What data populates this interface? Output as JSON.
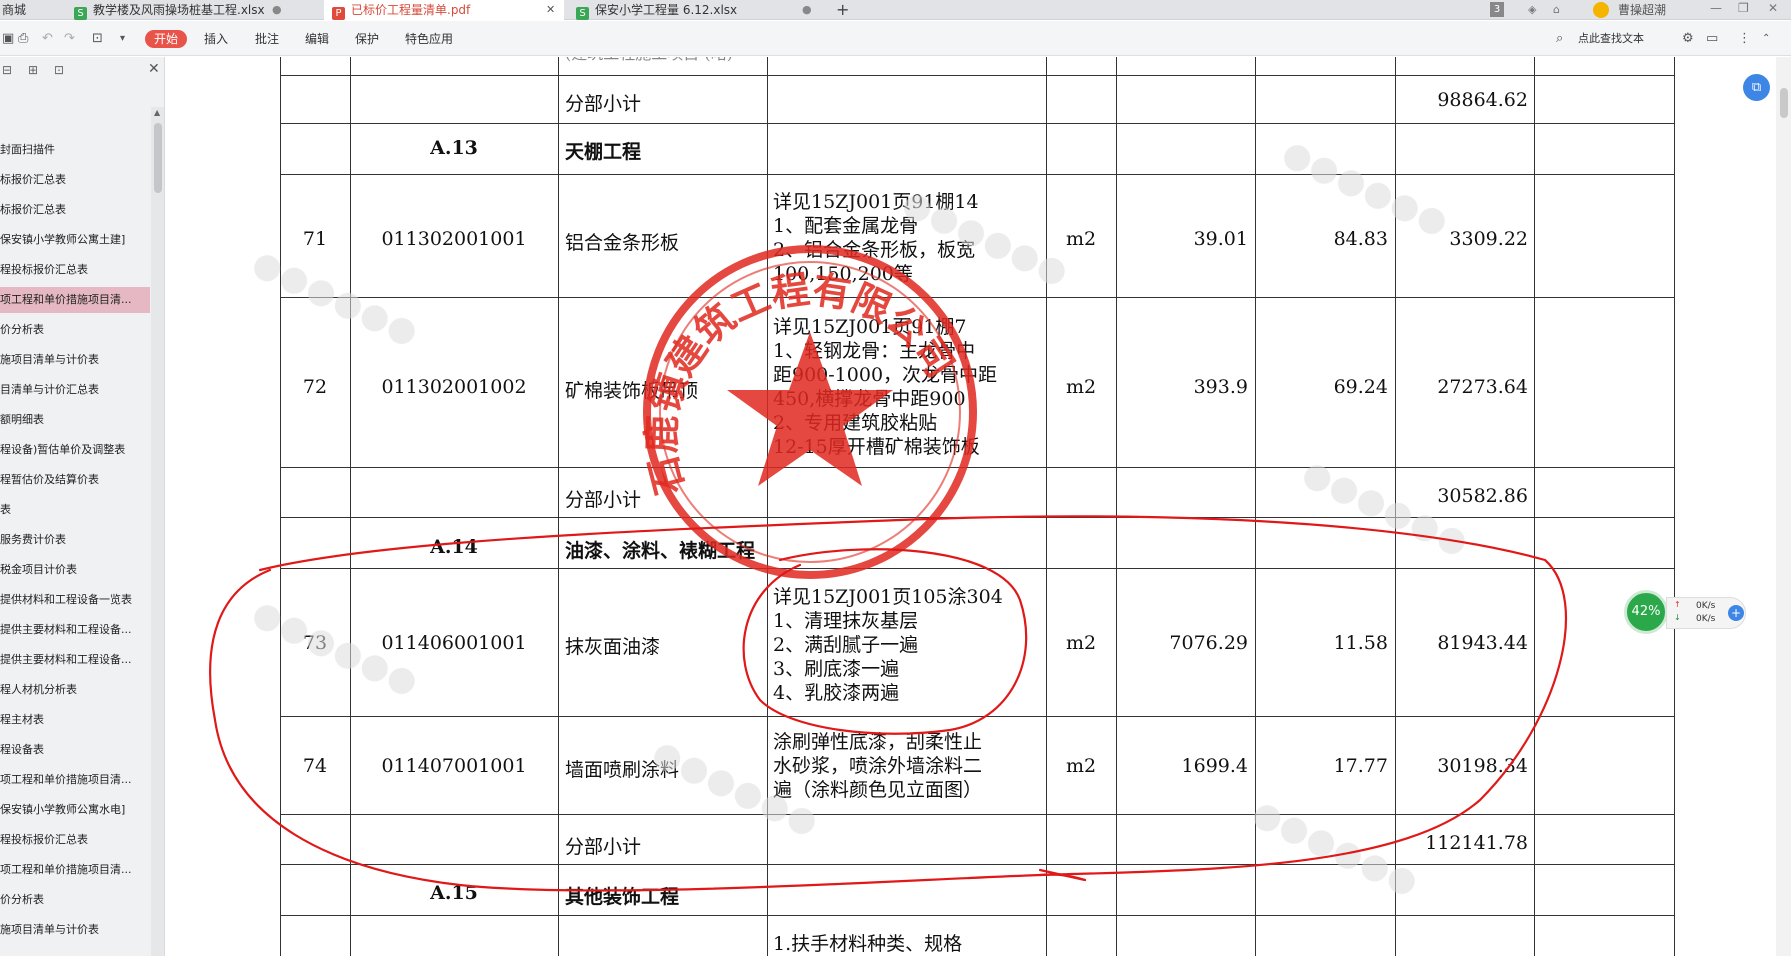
{
  "tabs": [
    {
      "label": "商城"
    },
    {
      "label": "教学楼及风雨操场桩基工程.xlsx",
      "icon": "S"
    },
    {
      "label": "已标价工程量清单.pdf",
      "icon": "P"
    },
    {
      "label": "保安小学工程量 6.12.xlsx",
      "icon": "S"
    }
  ],
  "titlebar": {
    "badge": "3",
    "user": "曹操超潮",
    "add": "+"
  },
  "toolbar": {
    "menus": [
      "开始",
      "插入",
      "批注",
      "编辑",
      "保护",
      "特色应用"
    ],
    "search_label": "点此查找文本"
  },
  "sidebar": {
    "items": [
      "封面扫描件",
      "标报价汇总表",
      "标报价汇总表",
      "保安镇小学教师公寓土建]",
      "程投标报价汇总表",
      "项工程和单价措施项目清...",
      "价分析表",
      "施项目清单与计价表",
      "目清单与计价汇总表",
      "额明细表",
      "程设备)暂估单价及调整表",
      "程暂估价及结算价表",
      "表",
      "服务费计价表",
      "税金项目计价表",
      "提供材料和工程设备一览表",
      "提供主要材料和工程设备...",
      "提供主要材料和工程设备...",
      "程人材机分析表",
      "程主材表",
      "程设备表",
      "项工程和单价措施项目清...",
      "保安镇小学教师公寓水电]",
      "程投标报价汇总表",
      "项工程和单价措施项目清...",
      "价分析表",
      "施项目清单与计价表"
    ],
    "selected_index": 5
  },
  "table": {
    "top_partial": "(建筑工程施工项目 (略)",
    "subtotal_1": {
      "label": "分部小计",
      "total": "98864.62"
    },
    "section_a13": {
      "code": "A.13",
      "name": "天棚工程"
    },
    "row_71": {
      "no": "71",
      "code": "011302001001",
      "name": "铝合金条形板",
      "desc": [
        "详见15ZJ001页91棚14",
        "1、配套金属龙骨",
        "2、铝合金条形板，板宽",
        "100,150,200等"
      ],
      "unit": "m2",
      "qty": "39.01",
      "price": "84.83",
      "total": "3309.22"
    },
    "row_72": {
      "no": "72",
      "code": "011302001002",
      "name": "矿棉装饰板吊顶",
      "desc": [
        "详见15ZJ001页91棚7",
        "1、轻钢龙骨：主龙骨中",
        "距900-1000，次龙骨中距",
        "450,横撑龙骨中距900",
        "2、专用建筑胶粘贴",
        "12-15厚开槽矿棉装饰板"
      ],
      "unit": "m2",
      "qty": "393.9",
      "price": "69.24",
      "total": "27273.64"
    },
    "subtotal_2": {
      "label": "分部小计",
      "total": "30582.86"
    },
    "section_a14": {
      "code": "A.14",
      "name": "油漆、涂料、裱糊工程"
    },
    "row_73": {
      "no": "73",
      "code": "011406001001",
      "name": "抹灰面油漆",
      "desc": [
        "详见15ZJ001页105涂304",
        "1、清理抹灰基层",
        "2、满刮腻子一遍",
        "3、刷底漆一遍",
        "4、乳胶漆两遍"
      ],
      "unit": "m2",
      "qty": "7076.29",
      "price": "11.58",
      "total": "81943.44"
    },
    "row_74": {
      "no": "74",
      "code": "011407001001",
      "name": "墙面喷刷涂料",
      "desc": [
        "涂刷弹性底漆，刮柔性止",
        "水砂浆，喷涂外墙涂料二",
        "遍（涂料颜色见立面图）"
      ],
      "unit": "m2",
      "qty": "1699.4",
      "price": "17.77",
      "total": "30198.34"
    },
    "subtotal_3": {
      "label": "分部小计",
      "total": "112141.78"
    },
    "section_a15": {
      "code": "A.15",
      "name": "其他装饰工程"
    },
    "row_next": {
      "desc": [
        "1.扶手材料种类、规格"
      ]
    }
  },
  "stamp": {
    "text": "石鹿镇建筑工程有限公司",
    "color": "#e0281e"
  },
  "speed": {
    "percent": "42%",
    "up": "0K/s",
    "down": "0K/s"
  },
  "colors": {
    "accent": "#e8534a",
    "annotation": "#e01818",
    "sidebar_selected": "#e5b8c3"
  }
}
